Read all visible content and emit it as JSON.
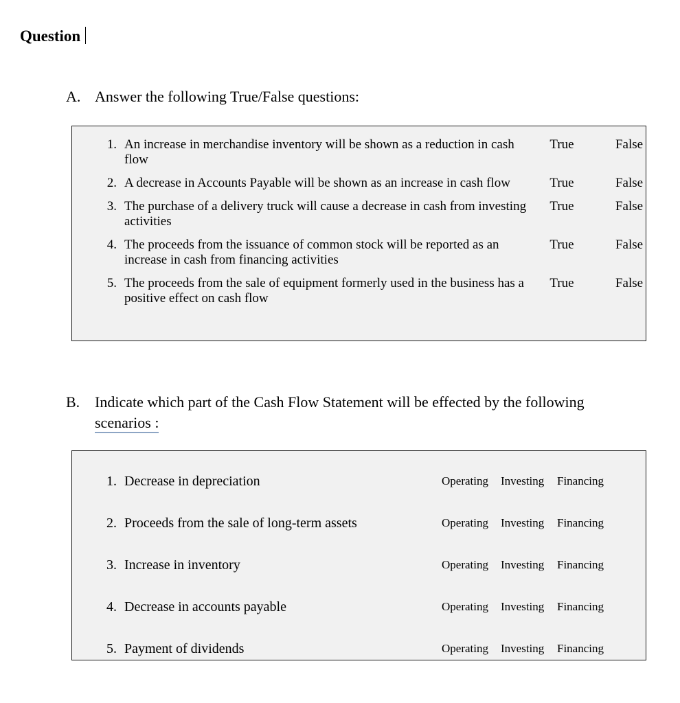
{
  "document": {
    "title": "Question",
    "caret_visible": true
  },
  "sections": [
    {
      "marker": "A.",
      "heading": "Answer the following True/False questions:"
    },
    {
      "marker": "B.",
      "heading_part1": "Indicate which part of the Cash Flow Statement will be effected by the following ",
      "heading_underlined": "scenarios :",
      "underline_color": "#8da5c4"
    }
  ],
  "table_a": {
    "options": [
      "True",
      "False"
    ],
    "rows": [
      {
        "num": "1.",
        "statement": "An increase in merchandise inventory will be shown as a reduction in cash flow",
        "option1": "True",
        "option2": "False"
      },
      {
        "num": "2.",
        "statement": "A decrease in Accounts Payable will be shown as an increase in cash flow",
        "option1": "True",
        "option2": "False"
      },
      {
        "num": "3.",
        "statement": "The purchase of a delivery truck will cause a decrease in cash from investing activities",
        "option1": "True",
        "option2": "False"
      },
      {
        "num": "4.",
        "statement": "The proceeds from the issuance of common stock will be reported as an increase in cash from financing activities",
        "option1": "True",
        "option2": "False"
      },
      {
        "num": "5.",
        "statement": "The proceeds from the sale of equipment formerly used in the business has a positive effect on cash flow",
        "option1": "True",
        "option2": "False"
      }
    ]
  },
  "table_b": {
    "options": [
      "Operating",
      "Investing",
      "Financing"
    ],
    "rows": [
      {
        "num": "1.",
        "statement": "Decrease in depreciation",
        "option1": "Operating",
        "option2": "Investing",
        "option3": "Financing"
      },
      {
        "num": "2.",
        "statement": "Proceeds from the sale of long-term assets",
        "option1": "Operating",
        "option2": "Investing",
        "option3": "Financing"
      },
      {
        "num": "3.",
        "statement": "Increase in inventory",
        "option1": "Operating",
        "option2": "Investing",
        "option3": "Financing"
      },
      {
        "num": "4.",
        "statement": "Decrease in accounts payable",
        "option1": "Operating",
        "option2": "Investing",
        "option3": "Financing"
      },
      {
        "num": "5.",
        "statement": "Payment of dividends",
        "option1": "Operating",
        "option2": "Investing",
        "option3": "Financing"
      }
    ]
  },
  "colors": {
    "page_background": "#ffffff",
    "table_background": "#f1f1f1",
    "table_border": "#1a1a1a",
    "text": "#000000"
  }
}
